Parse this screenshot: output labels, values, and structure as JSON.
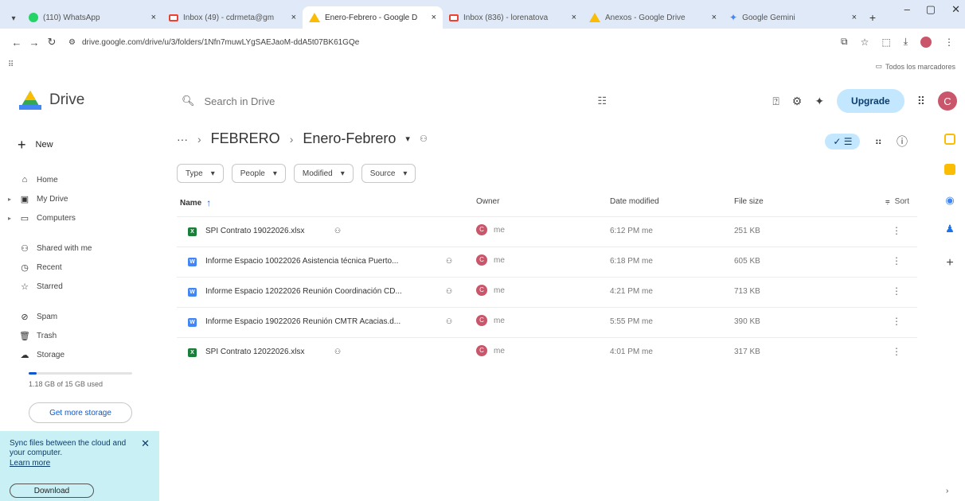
{
  "browser": {
    "tabs": [
      {
        "title": "(110) WhatsApp",
        "favicon": "whatsapp-icon",
        "active": false
      },
      {
        "title": "Inbox (49) - cdrmeta@gm",
        "favicon": "gmail-icon",
        "active": false
      },
      {
        "title": "Enero-Febrero - Google D",
        "favicon": "drive-icon",
        "active": true
      },
      {
        "title": "Inbox (836) - lorenatova",
        "favicon": "gmail-icon",
        "active": false
      },
      {
        "title": "Anexos - Google Drive",
        "favicon": "drive-icon",
        "active": false
      },
      {
        "title": "Google Gemini",
        "favicon": "gemini-icon",
        "active": false
      }
    ],
    "url": "drive.google.com/drive/u/3/folders/1Nfn7muwLYgSAEJaoM-ddA5t07BK61GQe",
    "all_bookmarks": "Todos los marcadores"
  },
  "drive": {
    "app_name": "Drive",
    "search_placeholder": "Search in Drive",
    "upgrade_label": "Upgrade",
    "avatar_letter": "C"
  },
  "sidebar": {
    "new_label": "New",
    "items": [
      {
        "label": "Home",
        "icon": "home-icon"
      },
      {
        "label": "My Drive",
        "icon": "my-drive-icon"
      },
      {
        "label": "Computers",
        "icon": "computer-icon"
      },
      {
        "label": "Shared with me",
        "icon": "people-icon"
      },
      {
        "label": "Recent",
        "icon": "clock-icon"
      },
      {
        "label": "Starred",
        "icon": "star-icon"
      },
      {
        "label": "Spam",
        "icon": "spam-icon"
      },
      {
        "label": "Trash",
        "icon": "trash-icon"
      },
      {
        "label": "Storage",
        "icon": "cloud-icon"
      }
    ],
    "storage_used_fraction": 0.079,
    "storage_text": "1.18 GB of 15 GB used",
    "get_storage_label": "Get more storage",
    "sync": {
      "text": "Sync files between the cloud and your computer.",
      "learn_more": "Learn more",
      "download_label": "Download"
    }
  },
  "main": {
    "breadcrumb": {
      "parent": "FEBRERO",
      "current": "Enero-Febrero"
    },
    "filters": [
      "Type",
      "People",
      "Modified",
      "Source"
    ],
    "columns": {
      "name": "Name",
      "owner": "Owner",
      "modified": "Date modified",
      "size": "File size",
      "sort": "Sort"
    },
    "files": [
      {
        "name": "SPI Contrato 19022026.xlsx",
        "type": "xlsx",
        "owner": "me",
        "modified": "6:12 PM me",
        "size": "251 KB"
      },
      {
        "name": "Informe Espacio 10022026 Asistencia técnica Puerto...",
        "type": "docx",
        "owner": "me",
        "modified": "6:18 PM me",
        "size": "605 KB"
      },
      {
        "name": "Informe Espacio 12022026 Reunión Coordinación CD...",
        "type": "docx",
        "owner": "me",
        "modified": "4:21 PM me",
        "size": "713 KB"
      },
      {
        "name": "Informe Espacio 19022026 Reunión CMTR Acacias.d...",
        "type": "docx",
        "owner": "me",
        "modified": "5:55 PM me",
        "size": "390 KB"
      },
      {
        "name": "SPI Contrato 12022026.xlsx",
        "type": "xlsx",
        "owner": "me",
        "modified": "4:01 PM me",
        "size": "317 KB"
      }
    ]
  },
  "colors": {
    "accent": "#0b57d0",
    "upgrade_bg": "#c2e7ff",
    "sync_bg": "#c8f0f5",
    "avatar": "#c9566a",
    "xlsx": "#188038",
    "docx": "#4285f4"
  }
}
